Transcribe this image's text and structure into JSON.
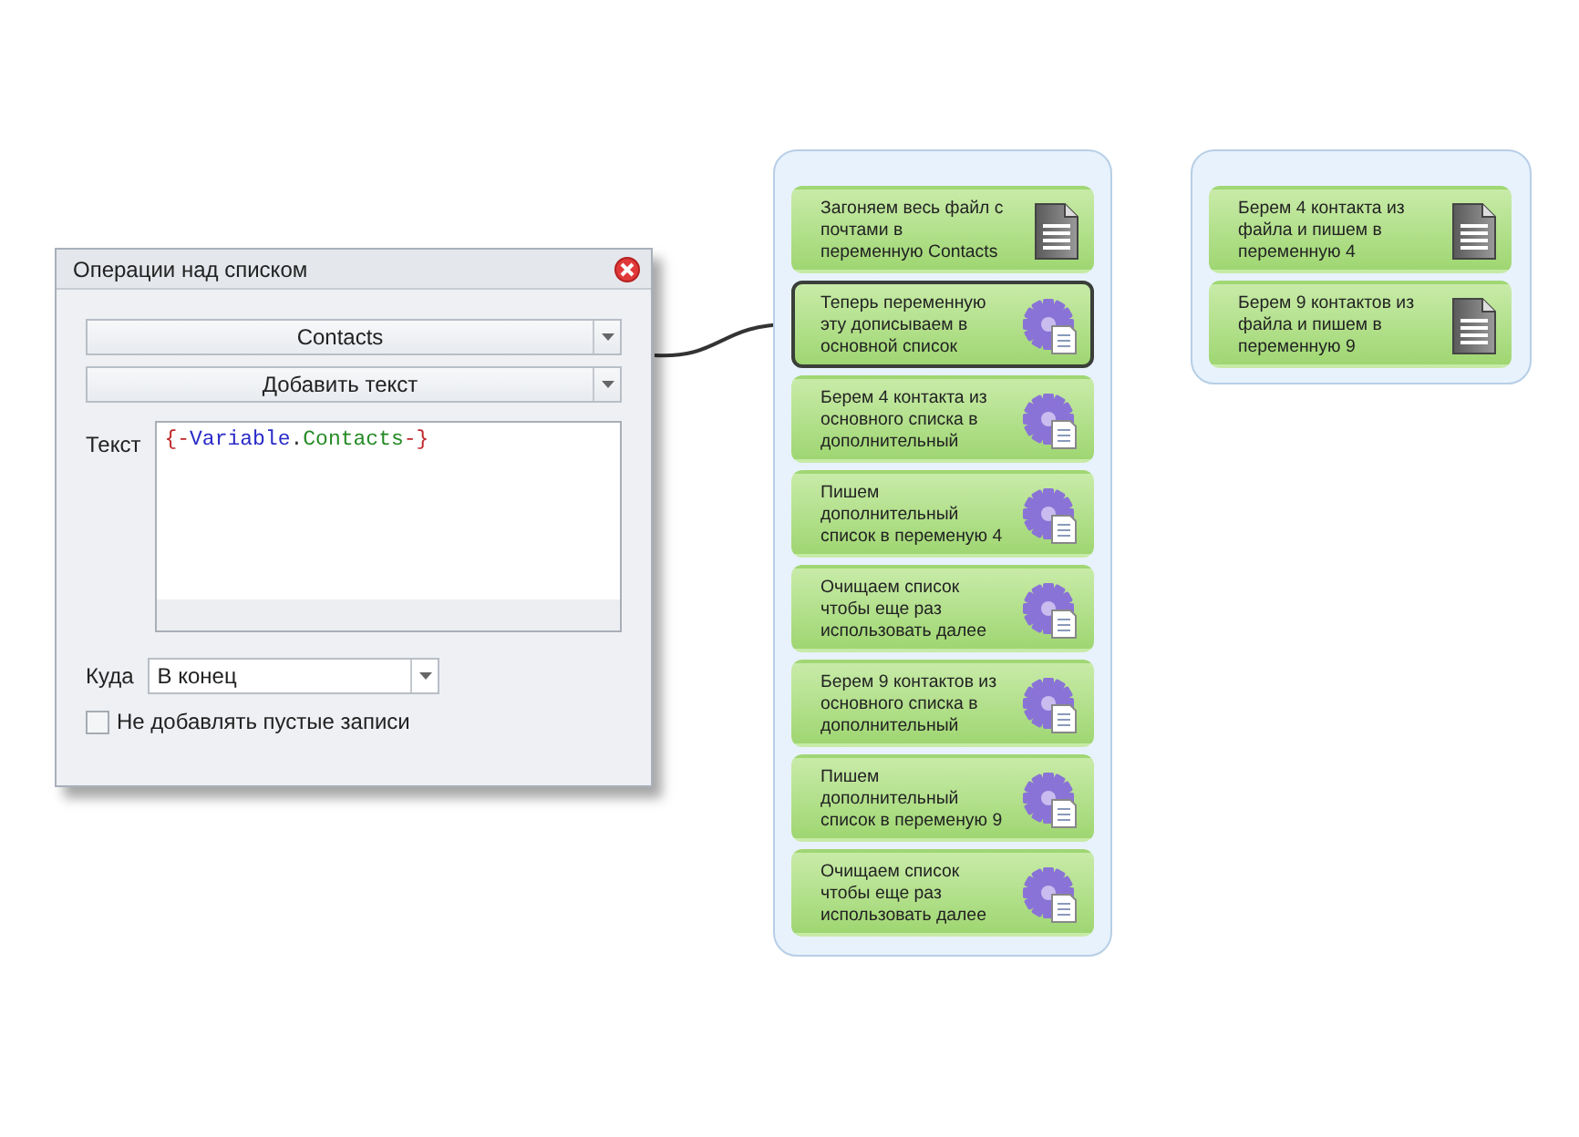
{
  "dialog": {
    "title": "Операции над списком",
    "list_select": "Contacts",
    "operation_select": "Добавить текст",
    "text_label": "Текст",
    "text_tokens": [
      {
        "kind": "delimiter",
        "text": "{-"
      },
      {
        "kind": "namespace",
        "text": "Variable"
      },
      {
        "kind": "punct",
        "text": "."
      },
      {
        "kind": "identifier",
        "text": "Contacts"
      },
      {
        "kind": "delimiter",
        "text": "-}"
      }
    ],
    "target_label": "Куда",
    "target_select": "В конец",
    "skip_empty": {
      "label": "Не добавлять пустые записи",
      "checked": false
    }
  },
  "groups": [
    {
      "nodes": [
        {
          "kind": "file",
          "text": "Загоняем весь файл с почтами в переменную Contacts",
          "selected": false
        },
        {
          "kind": "action",
          "text": "Теперь переменную эту дописываем в основной список",
          "selected": true
        },
        {
          "kind": "action",
          "text": "Берем 4 контакта из основного списка в дополнительный",
          "selected": false
        },
        {
          "kind": "action",
          "text": "Пишем дополнительный список в переменую 4",
          "selected": false
        },
        {
          "kind": "action",
          "text": "Очищаем список чтобы еще раз использовать далее",
          "selected": false
        },
        {
          "kind": "action",
          "text": "Берем 9 контактов из основного списка в дополнительный",
          "selected": false
        },
        {
          "kind": "action",
          "text": "Пишем дополнительный список в переменую 9",
          "selected": false
        },
        {
          "kind": "action",
          "text": "Очищаем список чтобы еще раз использовать далее",
          "selected": false
        }
      ]
    },
    {
      "nodes": [
        {
          "kind": "file",
          "text": "Берем 4 контакта из файла и пишем в переменную 4",
          "selected": false
        },
        {
          "kind": "file",
          "text": "Берем 9 контактов из файла и пишем в переменную 9",
          "selected": false
        }
      ]
    }
  ]
}
